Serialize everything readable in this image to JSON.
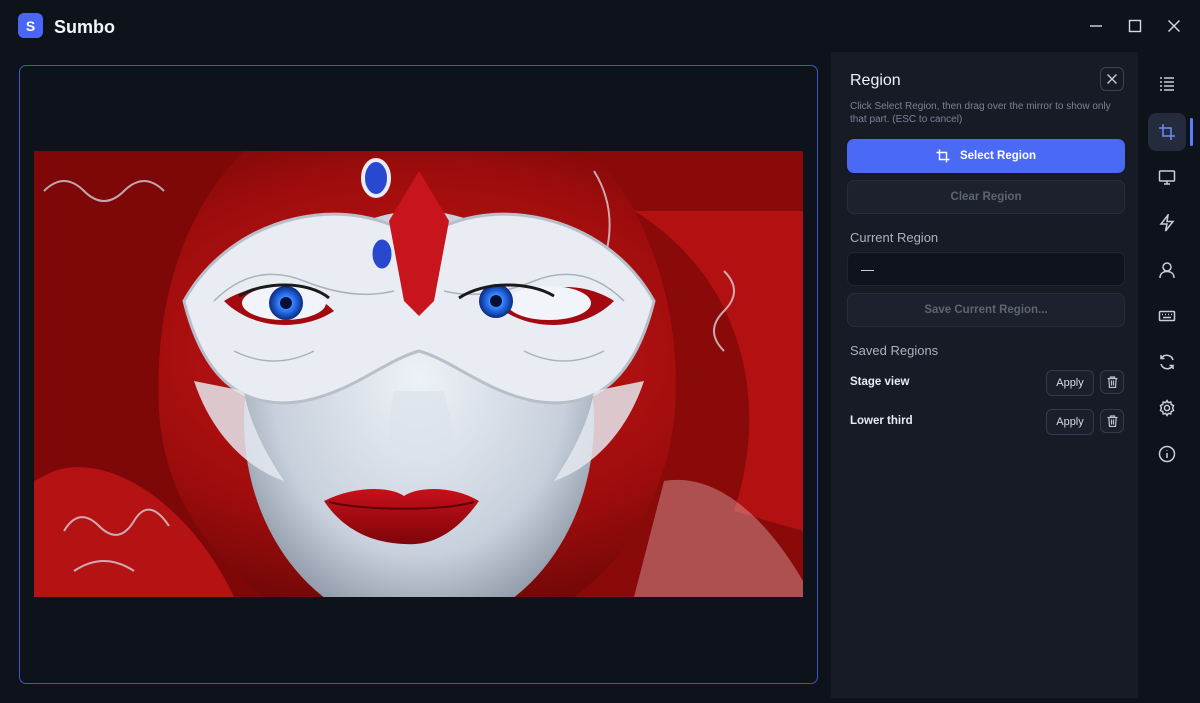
{
  "app": {
    "logo_letter": "S",
    "title": "Sumbo"
  },
  "window_controls": [
    "minimize-icon",
    "maximize-icon",
    "close-icon"
  ],
  "mirror": {
    "image": "Portrait of a woman in a white lace Venetian mask with blue eyes and red lips, wrapped in red embroidered fabric"
  },
  "panel": {
    "title": "Region",
    "hint": "Click Select Region, then drag over the mirror to show only that part. (ESC to cancel)",
    "select_region_label": "Select Region",
    "clear_region_label": "Clear Region",
    "current_region_label": "Current Region",
    "current_region_value": "—",
    "save_current_label": "Save Current Region...",
    "saved_regions_label": "Saved Regions",
    "saved_regions": [
      {
        "name": "Stage view",
        "apply_label": "Apply"
      },
      {
        "name": "Lower third",
        "apply_label": "Apply"
      }
    ]
  },
  "rail": {
    "items": [
      "list-icon",
      "crop-icon",
      "monitor-icon",
      "lightning-icon",
      "user-icon",
      "keyboard-icon",
      "refresh-icon",
      "gear-icon",
      "info-icon"
    ],
    "active": "crop-icon"
  },
  "colors": {
    "accent": "#4a6af6",
    "background": "#0e121b",
    "panel": "#161b26",
    "frame_border": "#3a55d8"
  }
}
